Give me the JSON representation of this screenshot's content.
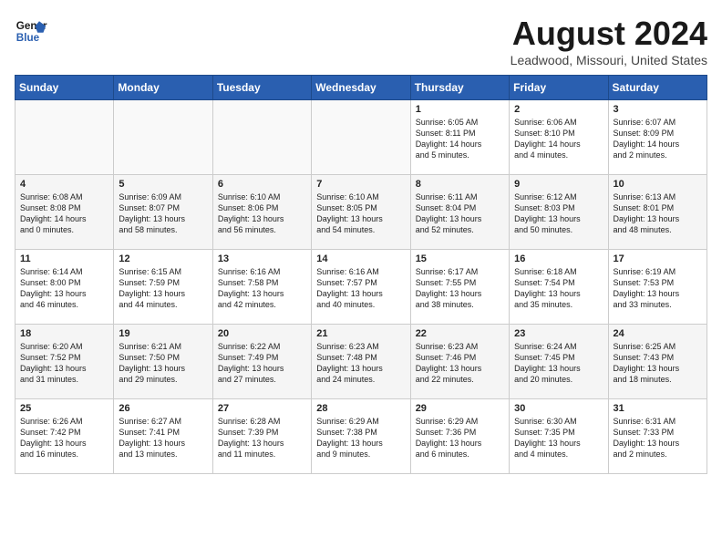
{
  "header": {
    "logo_line1": "General",
    "logo_line2": "Blue",
    "title": "August 2024",
    "subtitle": "Leadwood, Missouri, United States"
  },
  "weekdays": [
    "Sunday",
    "Monday",
    "Tuesday",
    "Wednesday",
    "Thursday",
    "Friday",
    "Saturday"
  ],
  "weeks": [
    [
      {
        "day": "",
        "content": ""
      },
      {
        "day": "",
        "content": ""
      },
      {
        "day": "",
        "content": ""
      },
      {
        "day": "",
        "content": ""
      },
      {
        "day": "1",
        "content": "Sunrise: 6:05 AM\nSunset: 8:11 PM\nDaylight: 14 hours\nand 5 minutes."
      },
      {
        "day": "2",
        "content": "Sunrise: 6:06 AM\nSunset: 8:10 PM\nDaylight: 14 hours\nand 4 minutes."
      },
      {
        "day": "3",
        "content": "Sunrise: 6:07 AM\nSunset: 8:09 PM\nDaylight: 14 hours\nand 2 minutes."
      }
    ],
    [
      {
        "day": "4",
        "content": "Sunrise: 6:08 AM\nSunset: 8:08 PM\nDaylight: 14 hours\nand 0 minutes."
      },
      {
        "day": "5",
        "content": "Sunrise: 6:09 AM\nSunset: 8:07 PM\nDaylight: 13 hours\nand 58 minutes."
      },
      {
        "day": "6",
        "content": "Sunrise: 6:10 AM\nSunset: 8:06 PM\nDaylight: 13 hours\nand 56 minutes."
      },
      {
        "day": "7",
        "content": "Sunrise: 6:10 AM\nSunset: 8:05 PM\nDaylight: 13 hours\nand 54 minutes."
      },
      {
        "day": "8",
        "content": "Sunrise: 6:11 AM\nSunset: 8:04 PM\nDaylight: 13 hours\nand 52 minutes."
      },
      {
        "day": "9",
        "content": "Sunrise: 6:12 AM\nSunset: 8:03 PM\nDaylight: 13 hours\nand 50 minutes."
      },
      {
        "day": "10",
        "content": "Sunrise: 6:13 AM\nSunset: 8:01 PM\nDaylight: 13 hours\nand 48 minutes."
      }
    ],
    [
      {
        "day": "11",
        "content": "Sunrise: 6:14 AM\nSunset: 8:00 PM\nDaylight: 13 hours\nand 46 minutes."
      },
      {
        "day": "12",
        "content": "Sunrise: 6:15 AM\nSunset: 7:59 PM\nDaylight: 13 hours\nand 44 minutes."
      },
      {
        "day": "13",
        "content": "Sunrise: 6:16 AM\nSunset: 7:58 PM\nDaylight: 13 hours\nand 42 minutes."
      },
      {
        "day": "14",
        "content": "Sunrise: 6:16 AM\nSunset: 7:57 PM\nDaylight: 13 hours\nand 40 minutes."
      },
      {
        "day": "15",
        "content": "Sunrise: 6:17 AM\nSunset: 7:55 PM\nDaylight: 13 hours\nand 38 minutes."
      },
      {
        "day": "16",
        "content": "Sunrise: 6:18 AM\nSunset: 7:54 PM\nDaylight: 13 hours\nand 35 minutes."
      },
      {
        "day": "17",
        "content": "Sunrise: 6:19 AM\nSunset: 7:53 PM\nDaylight: 13 hours\nand 33 minutes."
      }
    ],
    [
      {
        "day": "18",
        "content": "Sunrise: 6:20 AM\nSunset: 7:52 PM\nDaylight: 13 hours\nand 31 minutes."
      },
      {
        "day": "19",
        "content": "Sunrise: 6:21 AM\nSunset: 7:50 PM\nDaylight: 13 hours\nand 29 minutes."
      },
      {
        "day": "20",
        "content": "Sunrise: 6:22 AM\nSunset: 7:49 PM\nDaylight: 13 hours\nand 27 minutes."
      },
      {
        "day": "21",
        "content": "Sunrise: 6:23 AM\nSunset: 7:48 PM\nDaylight: 13 hours\nand 24 minutes."
      },
      {
        "day": "22",
        "content": "Sunrise: 6:23 AM\nSunset: 7:46 PM\nDaylight: 13 hours\nand 22 minutes."
      },
      {
        "day": "23",
        "content": "Sunrise: 6:24 AM\nSunset: 7:45 PM\nDaylight: 13 hours\nand 20 minutes."
      },
      {
        "day": "24",
        "content": "Sunrise: 6:25 AM\nSunset: 7:43 PM\nDaylight: 13 hours\nand 18 minutes."
      }
    ],
    [
      {
        "day": "25",
        "content": "Sunrise: 6:26 AM\nSunset: 7:42 PM\nDaylight: 13 hours\nand 16 minutes."
      },
      {
        "day": "26",
        "content": "Sunrise: 6:27 AM\nSunset: 7:41 PM\nDaylight: 13 hours\nand 13 minutes."
      },
      {
        "day": "27",
        "content": "Sunrise: 6:28 AM\nSunset: 7:39 PM\nDaylight: 13 hours\nand 11 minutes."
      },
      {
        "day": "28",
        "content": "Sunrise: 6:29 AM\nSunset: 7:38 PM\nDaylight: 13 hours\nand 9 minutes."
      },
      {
        "day": "29",
        "content": "Sunrise: 6:29 AM\nSunset: 7:36 PM\nDaylight: 13 hours\nand 6 minutes."
      },
      {
        "day": "30",
        "content": "Sunrise: 6:30 AM\nSunset: 7:35 PM\nDaylight: 13 hours\nand 4 minutes."
      },
      {
        "day": "31",
        "content": "Sunrise: 6:31 AM\nSunset: 7:33 PM\nDaylight: 13 hours\nand 2 minutes."
      }
    ]
  ]
}
